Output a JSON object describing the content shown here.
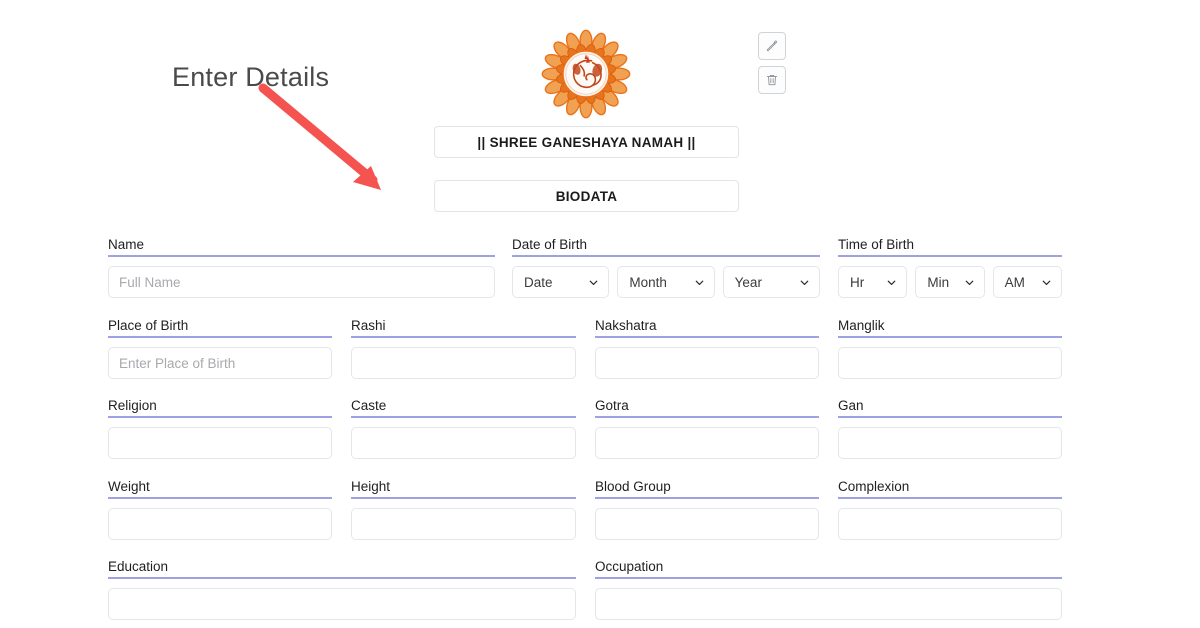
{
  "annotation": {
    "label": "Enter Details",
    "arrow_color": "#F4534F"
  },
  "header": {
    "logo_alt": "ganesha-lotus-logo",
    "logo_colors": {
      "petal_outer": "#E8731C",
      "petal_inner": "#F2A24B",
      "figure": "#C1471B"
    },
    "edit_button_label": "pencil-icon",
    "delete_button_label": "trash-icon",
    "mantra_text": "|| SHREE GANESHAYA NAMAH ||",
    "biodata_text": "BIODATA"
  },
  "form": {
    "label_underline_color": "#9EA2E3",
    "rows": [
      {
        "fields": [
          {
            "label": "Name",
            "type": "text",
            "value": "",
            "placeholder": "Full Name",
            "name": "name"
          },
          {
            "label": "Date of Birth",
            "type": "selects",
            "name": "date-of-birth",
            "selects": [
              {
                "name": "date",
                "value": "Date"
              },
              {
                "name": "month",
                "value": "Month"
              },
              {
                "name": "year",
                "value": "Year"
              }
            ]
          },
          {
            "label": "Time of Birth",
            "type": "selects",
            "name": "time-of-birth",
            "selects": [
              {
                "name": "hour",
                "value": "Hr"
              },
              {
                "name": "minute",
                "value": "Min"
              },
              {
                "name": "meridiem",
                "value": "AM"
              }
            ]
          }
        ]
      },
      {
        "fields": [
          {
            "label": "Place of Birth",
            "type": "text",
            "value": "",
            "placeholder": "Enter Place of Birth",
            "name": "place-of-birth"
          },
          {
            "label": "Rashi",
            "type": "text",
            "value": "",
            "placeholder": "",
            "name": "rashi"
          },
          {
            "label": "Nakshatra",
            "type": "text",
            "value": "",
            "placeholder": "",
            "name": "nakshatra"
          },
          {
            "label": "Manglik",
            "type": "text",
            "value": "",
            "placeholder": "",
            "name": "manglik"
          }
        ]
      },
      {
        "fields": [
          {
            "label": "Religion",
            "type": "text",
            "value": "",
            "placeholder": "",
            "name": "religion"
          },
          {
            "label": "Caste",
            "type": "text",
            "value": "",
            "placeholder": "",
            "name": "caste"
          },
          {
            "label": "Gotra",
            "type": "text",
            "value": "",
            "placeholder": "",
            "name": "gotra"
          },
          {
            "label": "Gan",
            "type": "text",
            "value": "",
            "placeholder": "",
            "name": "gan"
          }
        ]
      },
      {
        "fields": [
          {
            "label": "Weight",
            "type": "text",
            "value": "",
            "placeholder": "",
            "name": "weight"
          },
          {
            "label": "Height",
            "type": "text",
            "value": "",
            "placeholder": "",
            "name": "height"
          },
          {
            "label": "Blood Group",
            "type": "text",
            "value": "",
            "placeholder": "",
            "name": "blood-group"
          },
          {
            "label": "Complexion",
            "type": "text",
            "value": "",
            "placeholder": "",
            "name": "complexion"
          }
        ]
      },
      {
        "fields": [
          {
            "label": "Education",
            "type": "text",
            "value": "",
            "placeholder": "",
            "name": "education"
          },
          {
            "label": "Occupation",
            "type": "text",
            "value": "",
            "placeholder": "",
            "name": "occupation"
          }
        ]
      }
    ]
  }
}
